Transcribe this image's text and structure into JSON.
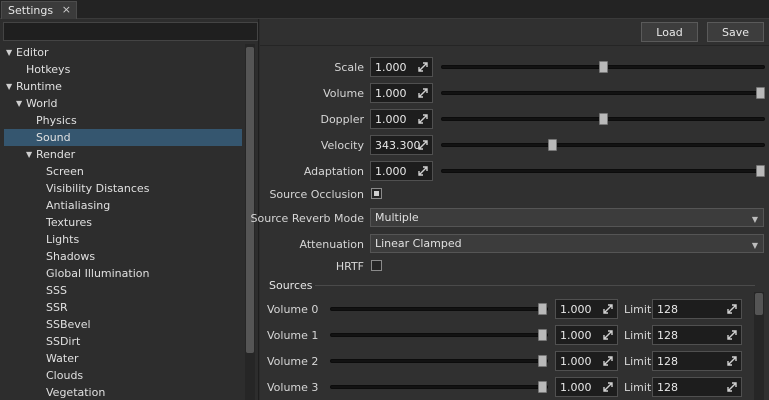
{
  "tab": {
    "title": "Settings",
    "close": "×"
  },
  "search": {
    "placeholder": ""
  },
  "tree": [
    {
      "label": "Editor",
      "arrow": "▼"
    },
    {
      "label": "Hotkeys",
      "arrow": ""
    },
    {
      "label": "Runtime",
      "arrow": "▼"
    },
    {
      "label": "World",
      "arrow": "▼"
    },
    {
      "label": "Physics",
      "arrow": ""
    },
    {
      "label": "Sound",
      "arrow": "",
      "selected": true
    },
    {
      "label": "Render",
      "arrow": "▼"
    },
    {
      "label": "Screen",
      "arrow": ""
    },
    {
      "label": "Visibility Distances",
      "arrow": ""
    },
    {
      "label": "Antialiasing",
      "arrow": ""
    },
    {
      "label": "Textures",
      "arrow": ""
    },
    {
      "label": "Lights",
      "arrow": ""
    },
    {
      "label": "Shadows",
      "arrow": ""
    },
    {
      "label": "Global Illumination",
      "arrow": ""
    },
    {
      "label": "SSS",
      "arrow": ""
    },
    {
      "label": "SSR",
      "arrow": ""
    },
    {
      "label": "SSBevel",
      "arrow": ""
    },
    {
      "label": "SSDirt",
      "arrow": ""
    },
    {
      "label": "Water",
      "arrow": ""
    },
    {
      "label": "Clouds",
      "arrow": ""
    },
    {
      "label": "Vegetation",
      "arrow": ""
    }
  ],
  "toolbar": {
    "load_label": "Load",
    "save_label": "Save"
  },
  "properties": {
    "sliders": [
      {
        "label": "Scale",
        "value": "1.000",
        "level": 0.5
      },
      {
        "label": "Volume",
        "value": "1.000",
        "level": 1.0
      },
      {
        "label": "Doppler",
        "value": "1.000",
        "level": 0.5
      },
      {
        "label": "Velocity",
        "value": "343.300",
        "level": 0.34
      },
      {
        "label": "Adaptation",
        "value": "1.000",
        "level": 1.0
      }
    ],
    "source_occlusion": {
      "label": "Source Occlusion",
      "checked": true
    },
    "source_reverb_mode": {
      "label": "Source Reverb Mode",
      "value": "Multiple"
    },
    "attenuation": {
      "label": "Attenuation",
      "value": "Linear Clamped"
    },
    "hrtf": {
      "label": "HRTF",
      "checked": false
    }
  },
  "sources": {
    "title": "Sources",
    "limit_label": "Limit",
    "items": [
      {
        "label": "Volume 0",
        "value": "1.000",
        "limit": "128",
        "level": 1.0
      },
      {
        "label": "Volume 1",
        "value": "1.000",
        "limit": "128",
        "level": 1.0
      },
      {
        "label": "Volume 2",
        "value": "1.000",
        "limit": "128",
        "level": 1.0
      },
      {
        "label": "Volume 3",
        "value": "1.000",
        "limit": "128",
        "level": 1.0
      }
    ]
  }
}
